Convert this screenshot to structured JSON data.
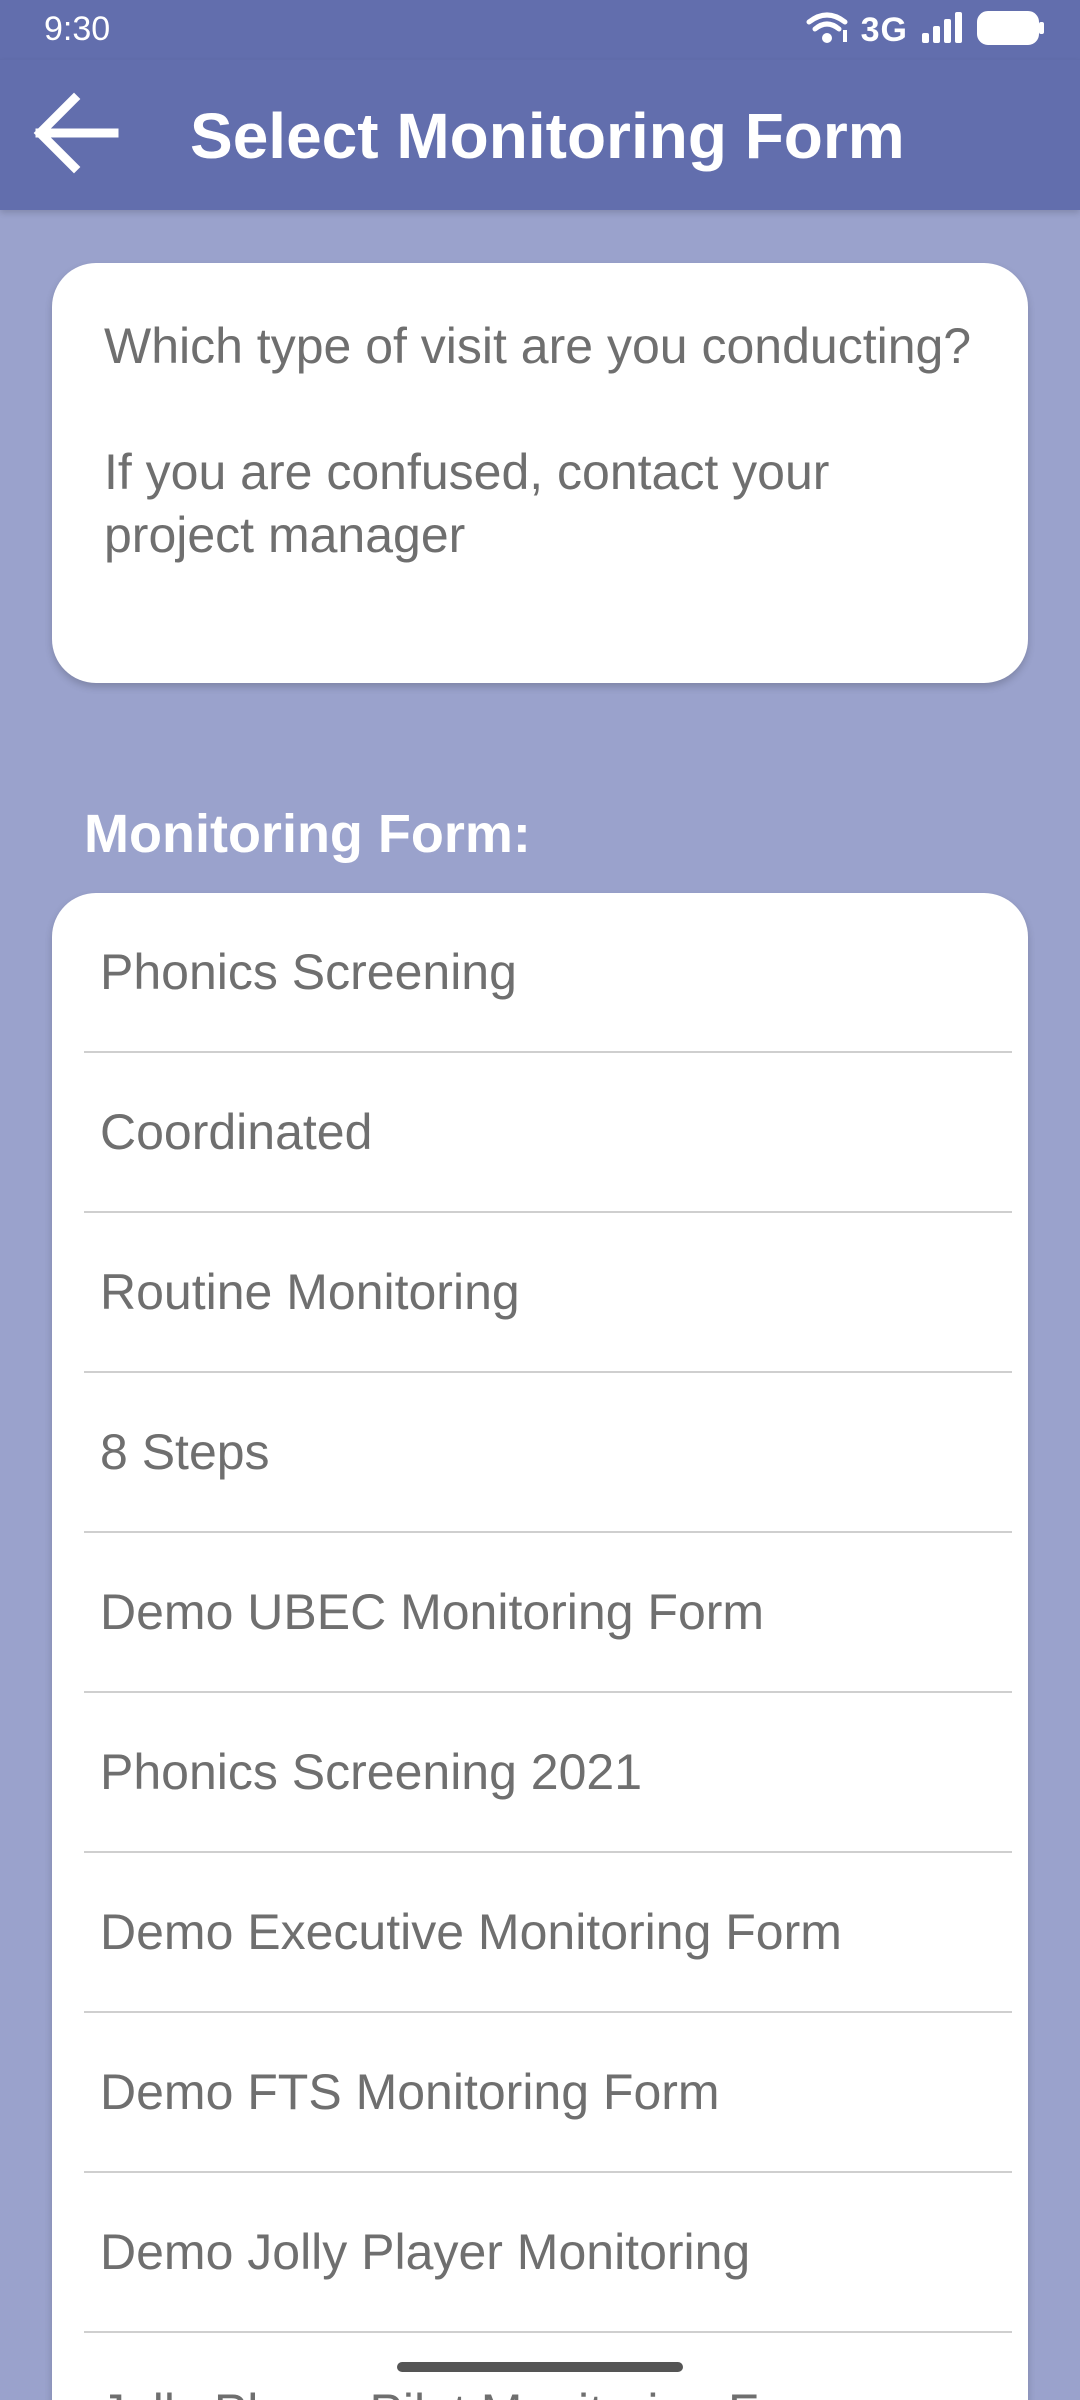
{
  "status_bar": {
    "time": "9:30",
    "network": "3G",
    "icons": [
      "wifi-icon",
      "signal-icon",
      "battery-icon"
    ]
  },
  "app_bar": {
    "back_icon": "arrow-back-icon",
    "title": "Select Monitoring Form"
  },
  "info_card": {
    "question": "Which type of visit are you conducting?",
    "hint": "If you are confused, contact your project manager"
  },
  "section_label": "Monitoring Form:",
  "forms": [
    "Phonics Screening",
    "Coordinated",
    "Routine Monitoring",
    "8 Steps",
    "Demo UBEC Monitoring Form",
    "Phonics Screening 2021",
    "Demo Executive Monitoring Form",
    "Demo FTS Monitoring Form",
    "Demo Jolly Player Monitoring",
    "Jolly Player Pilot Monitoring Form"
  ],
  "colors": {
    "app_bar": "#626ead",
    "background": "#9aa2cc",
    "card": "#ffffff",
    "text_secondary": "#6f6f6f",
    "divider": "#cfcfcf"
  }
}
